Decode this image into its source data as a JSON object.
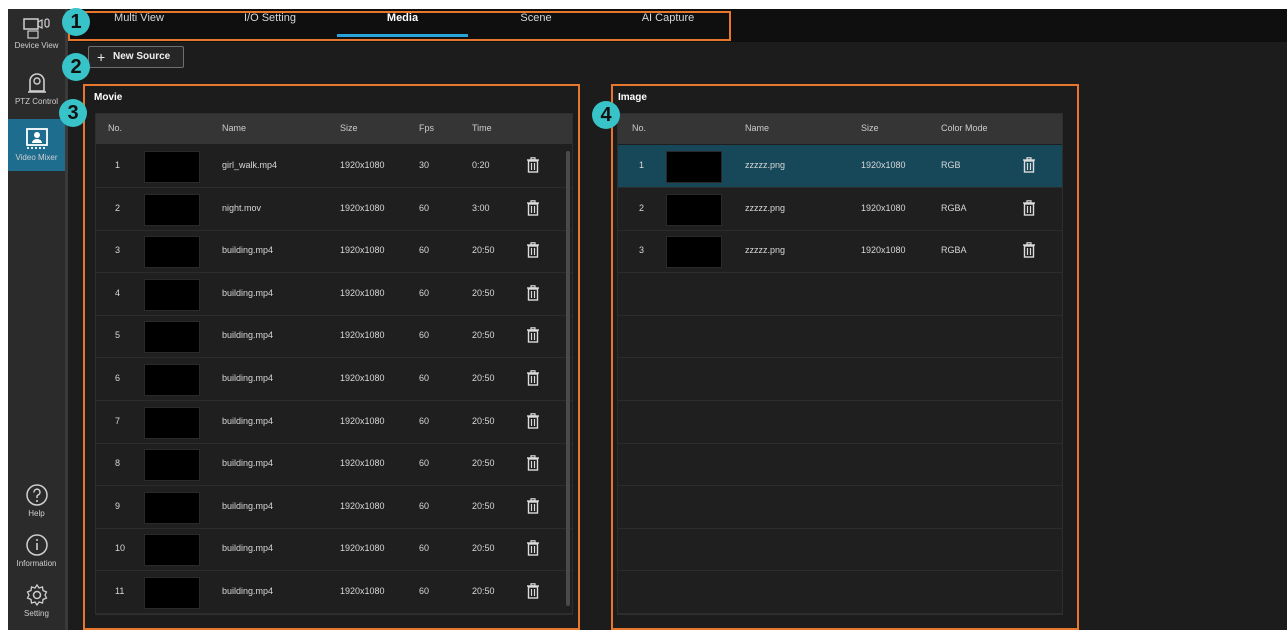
{
  "sidebar": {
    "items": [
      {
        "label": "Device View",
        "icon": "device-view-icon"
      },
      {
        "label": "PTZ Control",
        "icon": "ptz-camera-icon"
      },
      {
        "label": "Video Mixer",
        "icon": "video-mixer-icon",
        "active": true
      },
      {
        "label": "Help",
        "icon": "help-icon"
      },
      {
        "label": "Information",
        "icon": "info-icon"
      },
      {
        "label": "Setting",
        "icon": "gear-icon"
      }
    ]
  },
  "tabs": [
    {
      "label": "Multi View"
    },
    {
      "label": "I/O Setting"
    },
    {
      "label": "Media",
      "active": true
    },
    {
      "label": "Scene"
    },
    {
      "label": "AI Capture"
    }
  ],
  "toolbar": {
    "new_source_label": "New Source"
  },
  "annotations": {
    "b1": "1",
    "b2": "2",
    "b3": "3",
    "b4": "4"
  },
  "movie": {
    "title": "Movie",
    "headers": {
      "no": "No.",
      "name": "Name",
      "size": "Size",
      "fps": "Fps",
      "time": "Time"
    },
    "rows": [
      {
        "no": "1",
        "name": "girl_walk.mp4",
        "size": "1920x1080",
        "fps": "30",
        "time": "0:20"
      },
      {
        "no": "2",
        "name": "night.mov",
        "size": "1920x1080",
        "fps": "60",
        "time": "3:00"
      },
      {
        "no": "3",
        "name": "building.mp4",
        "size": "1920x1080",
        "fps": "60",
        "time": "20:50"
      },
      {
        "no": "4",
        "name": "building.mp4",
        "size": "1920x1080",
        "fps": "60",
        "time": "20:50"
      },
      {
        "no": "5",
        "name": "building.mp4",
        "size": "1920x1080",
        "fps": "60",
        "time": "20:50"
      },
      {
        "no": "6",
        "name": "building.mp4",
        "size": "1920x1080",
        "fps": "60",
        "time": "20:50"
      },
      {
        "no": "7",
        "name": "building.mp4",
        "size": "1920x1080",
        "fps": "60",
        "time": "20:50"
      },
      {
        "no": "8",
        "name": "building.mp4",
        "size": "1920x1080",
        "fps": "60",
        "time": "20:50"
      },
      {
        "no": "9",
        "name": "building.mp4",
        "size": "1920x1080",
        "fps": "60",
        "time": "20:50"
      },
      {
        "no": "10",
        "name": "building.mp4",
        "size": "1920x1080",
        "fps": "60",
        "time": "20:50"
      },
      {
        "no": "11",
        "name": "building.mp4",
        "size": "1920x1080",
        "fps": "60",
        "time": "20:50"
      }
    ]
  },
  "image": {
    "title": "Image",
    "headers": {
      "no": "No.",
      "name": "Name",
      "size": "Size",
      "color_mode": "Color Mode"
    },
    "rows": [
      {
        "no": "1",
        "name": "zzzzz.png",
        "size": "1920x1080",
        "color_mode": "RGB",
        "selected": true
      },
      {
        "no": "2",
        "name": "zzzzz.png",
        "size": "1920x1080",
        "color_mode": "RGBA"
      },
      {
        "no": "3",
        "name": "zzzzz.png",
        "size": "1920x1080",
        "color_mode": "RGBA"
      }
    ],
    "empty_rows": 8
  },
  "colors": {
    "accent": "#2aa3d8",
    "annotation": "#e8772e",
    "badge": "#38c3c8",
    "selected_row": "#17485a"
  }
}
